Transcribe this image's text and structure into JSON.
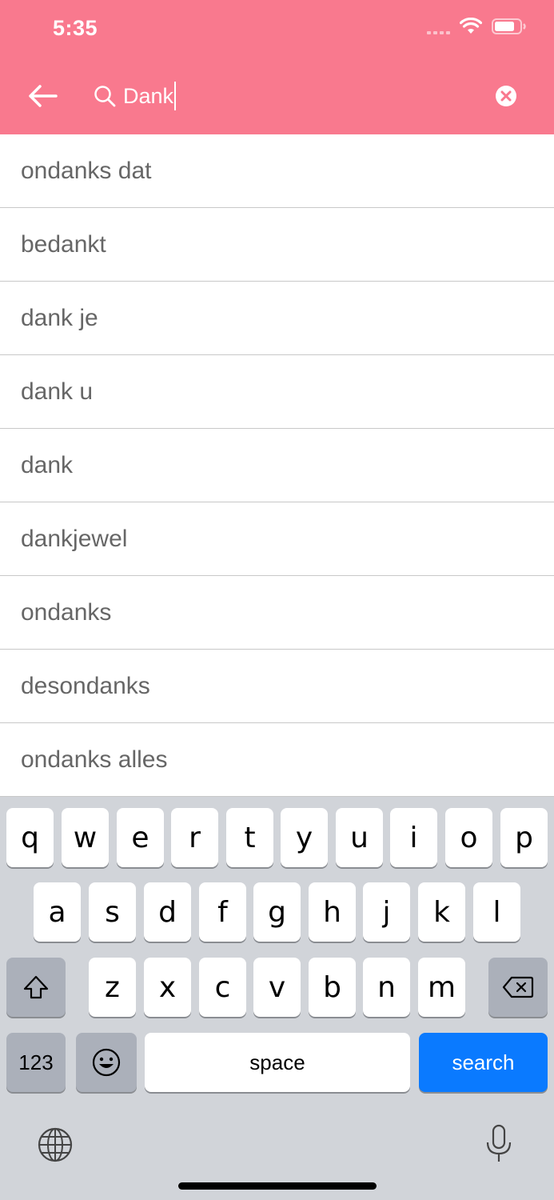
{
  "status_bar": {
    "time": "5:35"
  },
  "search": {
    "query": "Dank"
  },
  "suggestions": [
    "ondanks dat",
    "bedankt",
    "dank je",
    "dank u",
    "dank",
    "dankjewel",
    "ondanks",
    "desondanks",
    "ondanks alles"
  ],
  "keyboard": {
    "row1": [
      "q",
      "w",
      "e",
      "r",
      "t",
      "y",
      "u",
      "i",
      "o",
      "p"
    ],
    "row2": [
      "a",
      "s",
      "d",
      "f",
      "g",
      "h",
      "j",
      "k",
      "l"
    ],
    "row3": [
      "z",
      "x",
      "c",
      "v",
      "b",
      "n",
      "m"
    ],
    "numbers_label": "123",
    "space_label": "space",
    "search_label": "search"
  },
  "colors": {
    "header": "#f9798e",
    "search_key": "#0a7aff"
  }
}
